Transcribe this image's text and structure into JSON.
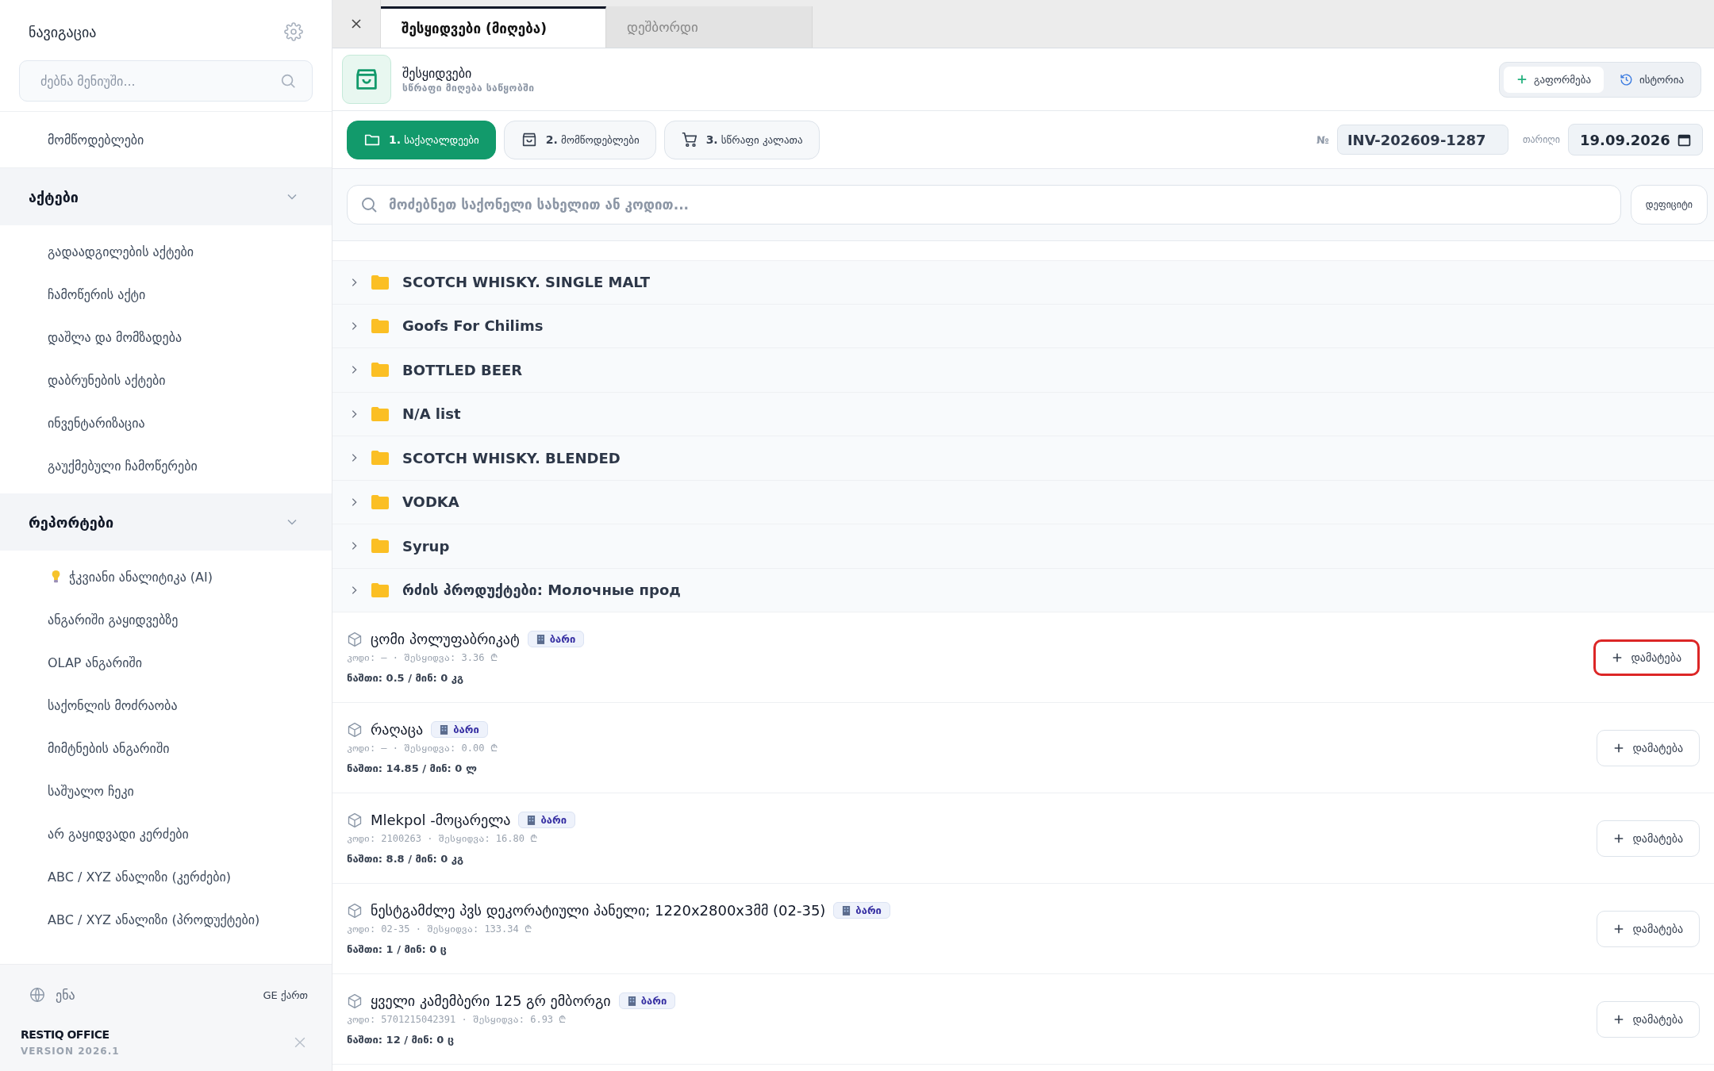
{
  "sidebar": {
    "title": "ნავიგაცია",
    "search": {
      "placeholder": "ძებნა მენიუში..."
    },
    "top_items": [
      {
        "label": "მომწოდებლები"
      }
    ],
    "sections": [
      {
        "title": "აქტები",
        "expanded": true,
        "items": [
          {
            "label": "გადაადგილების აქტები",
            "kind": "link"
          },
          {
            "label": "ჩამოწერის აქტი",
            "kind": "link"
          },
          {
            "label": "დაშლა და მომზადება",
            "kind": "link"
          },
          {
            "label": "დაბრუნების აქტები",
            "kind": "link"
          },
          {
            "label": "ინვენტარიზაცია",
            "kind": "link"
          },
          {
            "label": "გაუქმებული ჩამოწერები",
            "kind": "link"
          }
        ]
      },
      {
        "title": "რეპორტები",
        "expanded": true,
        "items": [
          {
            "label": "ჭკვიანი ანალიტიკა (AI)",
            "kind": "ai"
          },
          {
            "label": "ანგარიში გაყიდვებზე",
            "kind": "link"
          },
          {
            "label": "OLAP ანგარიში",
            "kind": "link"
          },
          {
            "label": "საქონლის მოძრაობა",
            "kind": "link"
          },
          {
            "label": "მიმტნების ანგარიში",
            "kind": "link"
          },
          {
            "label": "საშუალო ჩეკი",
            "kind": "link"
          },
          {
            "label": "არ გაყიდვადი კერძები",
            "kind": "link"
          },
          {
            "label": "ABC / XYZ ანალიზი (კერძები)",
            "kind": "link"
          },
          {
            "label": "ABC / XYZ ანალიზი (პროდუქტები)",
            "kind": "link"
          }
        ]
      }
    ],
    "language": {
      "label": "ენა",
      "value": "GE ქართ"
    },
    "brand": {
      "name": "RESTIQ OFFICE",
      "version": "VERSION 2026.1"
    }
  },
  "tabs": [
    {
      "label": "შესყიდვები (მიღება)",
      "selected": true
    },
    {
      "label": "დეშბორდი",
      "selected": false
    }
  ],
  "header": {
    "title": "შესყიდვები",
    "subtitle": "სწრაფი მიღება საწყობში",
    "actions": [
      {
        "label": "გაფორმება",
        "kind": "add",
        "selected": true
      },
      {
        "label": "ისტორია",
        "kind": "history",
        "selected": false
      }
    ]
  },
  "steps": [
    {
      "number": "1.",
      "label": "საქაღალდეები",
      "kind": "folder",
      "selected": true
    },
    {
      "number": "2.",
      "label": "მომწოდებლები",
      "kind": "bag",
      "selected": false
    },
    {
      "number": "3.",
      "label": "სწრაფი კალათა",
      "kind": "cart",
      "selected": false
    }
  ],
  "invoice": {
    "number_label": "№",
    "number": "INV-202609-1287",
    "date_label": "თარიღი",
    "date": "19.09.2026"
  },
  "search": {
    "placeholder": "მოძებნეთ საქონელი სახელით ან კოდით..."
  },
  "filter_button": "დეფიციტი",
  "folders": [
    "SCOTCH WHISKY. SINGLE MALT",
    "Goofs For Chilims",
    "BOTTLED BEER",
    "N/A list",
    "SCOTCH WHISKY. BLENDED",
    "VODKA",
    "Syrup",
    "რძის პროდუქტები: Молочные прод"
  ],
  "products": [
    {
      "name": "ცომი პოლუფაბრიკატ",
      "tag": "ბარი",
      "meta": "კოდი: — · შესყიდვა: 3.36 ₾",
      "stock": "ნაშთი: 0.5 / მინ: 0 კგ",
      "button": "დამატება",
      "highlighted": true
    },
    {
      "name": "რაღაცა",
      "tag": "ბარი",
      "meta": "კოდი: — · შესყიდვა: 0.00 ₾",
      "stock": "ნაშთი: 14.85 / მინ: 0 ლ",
      "button": "დამატება",
      "highlighted": false
    },
    {
      "name": "Mlekpol -მოცარელა",
      "tag": "ბარი",
      "meta": "კოდი: 2100263 · შესყიდვა: 16.80 ₾",
      "stock": "ნაშთი: 8.8 / მინ: 0 კგ",
      "button": "დამატება",
      "highlighted": false
    },
    {
      "name": "ნესტგამძლე პვს დეკორატიული პანელი; 1220x2800x3მმ (02-35)",
      "tag": "ბარი",
      "meta": "კოდი: 02-35 · შესყიდვა: 133.34 ₾",
      "stock": "ნაშთი: 1 / მინ: 0 ც",
      "button": "დამატება",
      "highlighted": false
    },
    {
      "name": "ყველი კამემბერი 125 გრ ემბორგი",
      "tag": "ბარი",
      "meta": "კოდი: 5701215042391 · შესყიდვა: 6.93 ₾",
      "stock": "ნაშთი: 12 / მინ: 0 ც",
      "button": "დამატება",
      "highlighted": false
    }
  ]
}
